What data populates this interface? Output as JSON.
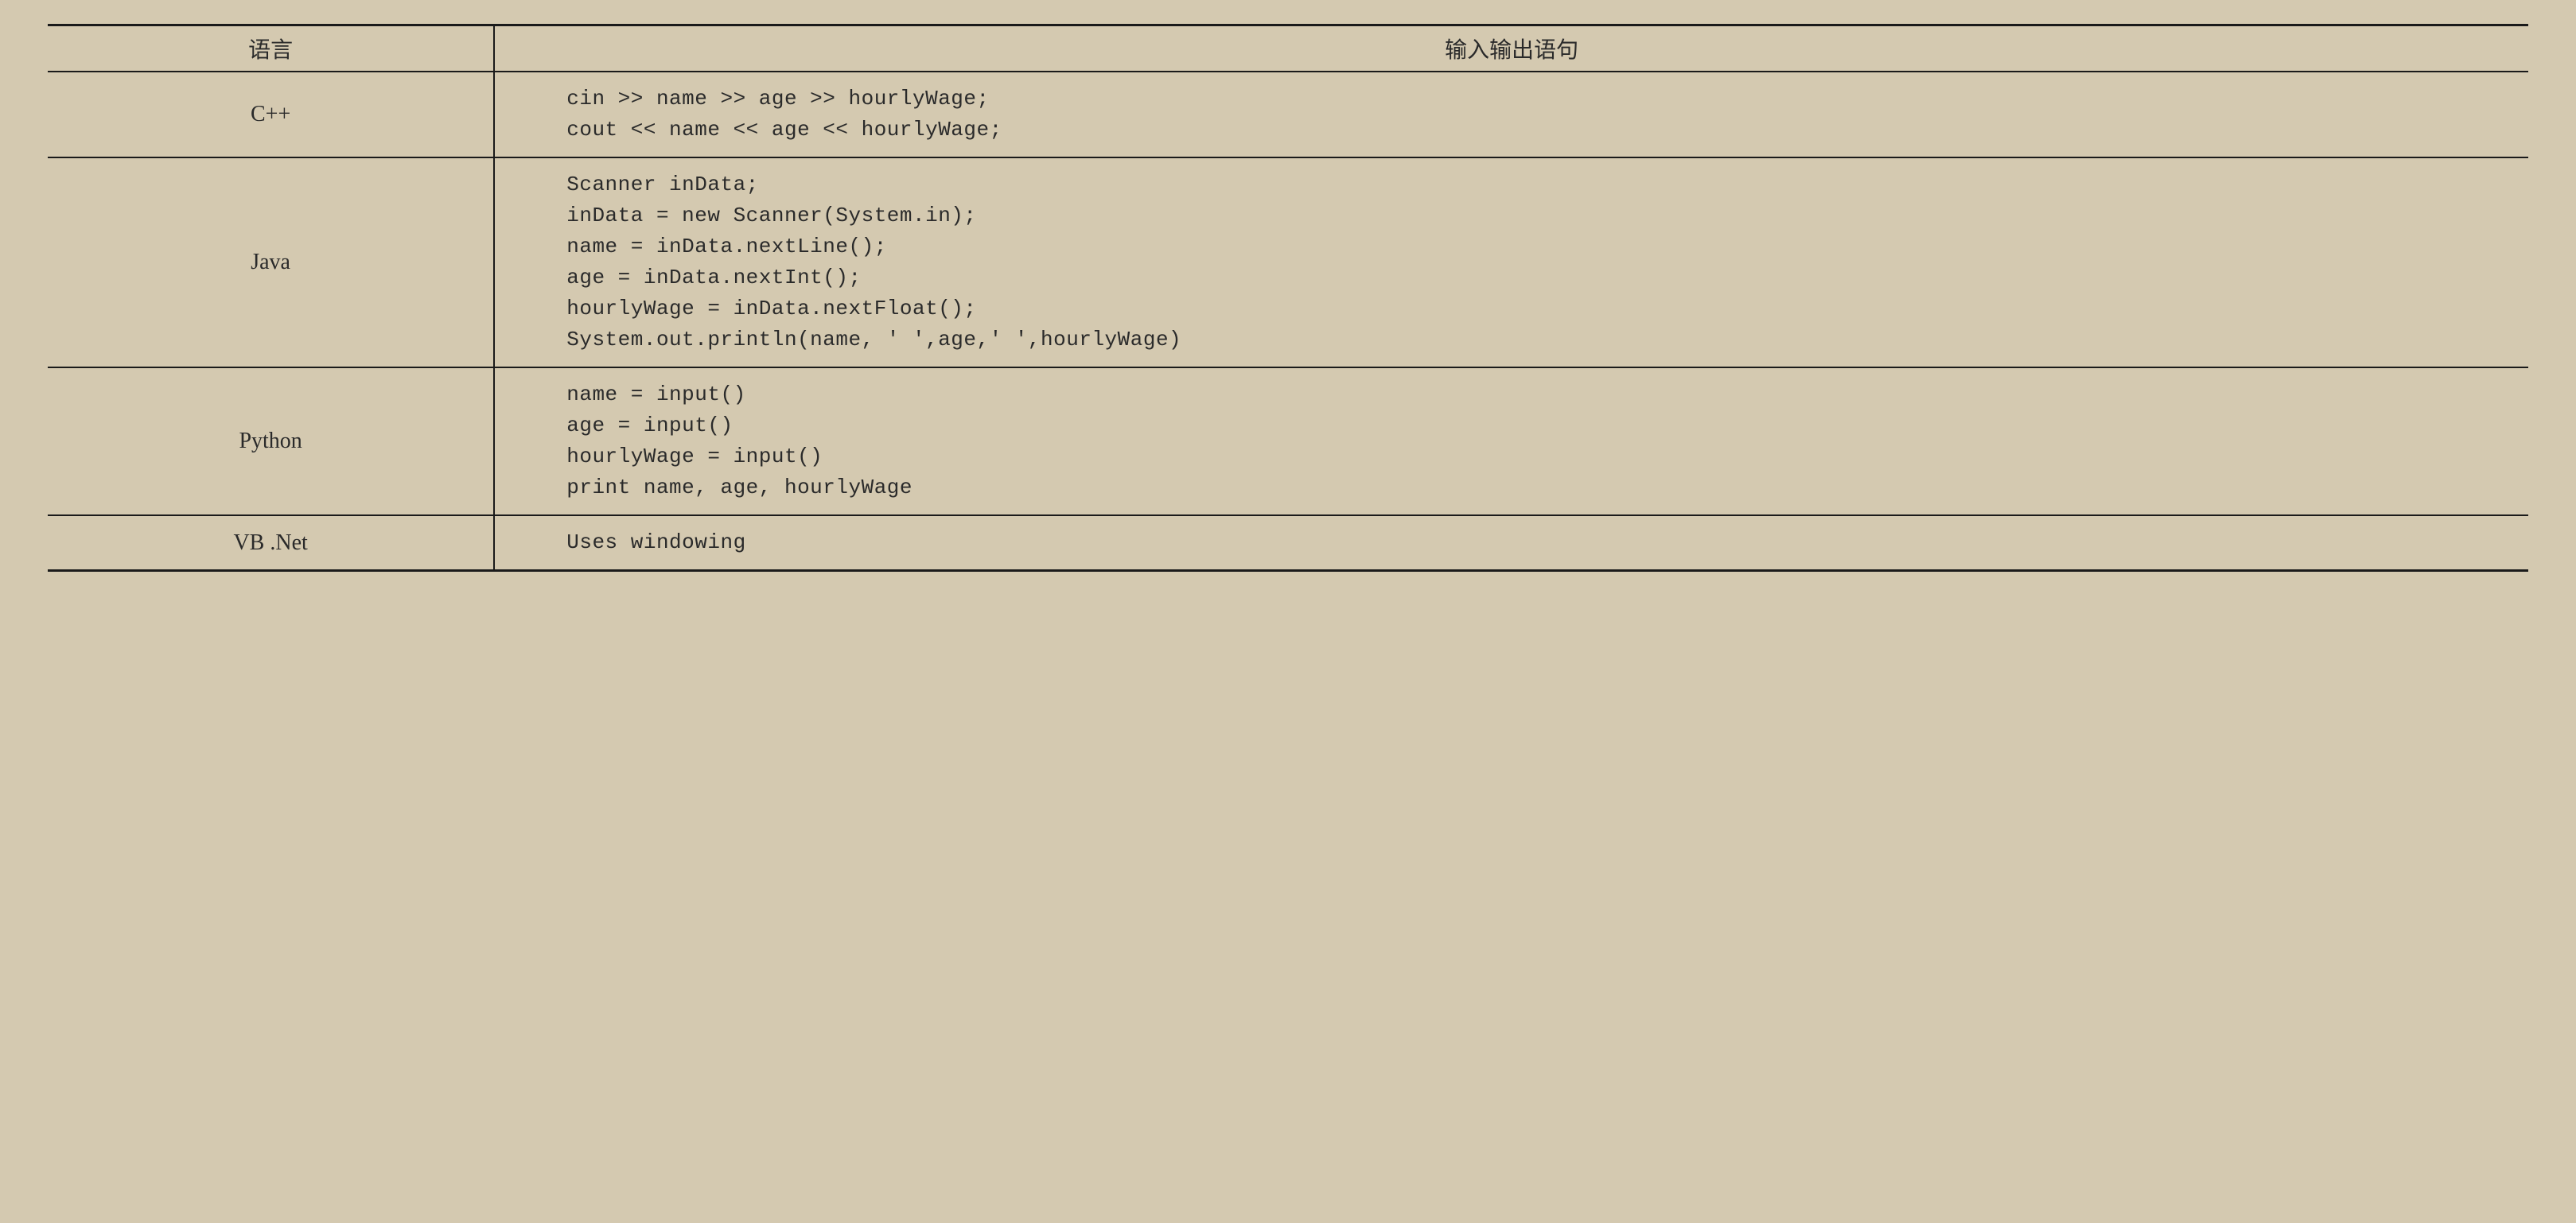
{
  "table": {
    "headers": {
      "language": "语言",
      "io_statement": "输入输出语句"
    },
    "rows": [
      {
        "language": "C++",
        "code": "cin >> name >> age >> hourlyWage;\ncout << name << age << hourlyWage;"
      },
      {
        "language": "Java",
        "code": "Scanner inData;\ninData = new Scanner(System.in);\nname = inData.nextLine();\nage = inData.nextInt();\nhourlyWage = inData.nextFloat();\nSystem.out.println(name, ' ',age,' ',hourlyWage)"
      },
      {
        "language": "Python",
        "code": "name = input()\nage = input()\nhourlyWage = input()\nprint name, age, hourlyWage"
      },
      {
        "language": "VB .Net",
        "code": "Uses windowing"
      }
    ]
  }
}
